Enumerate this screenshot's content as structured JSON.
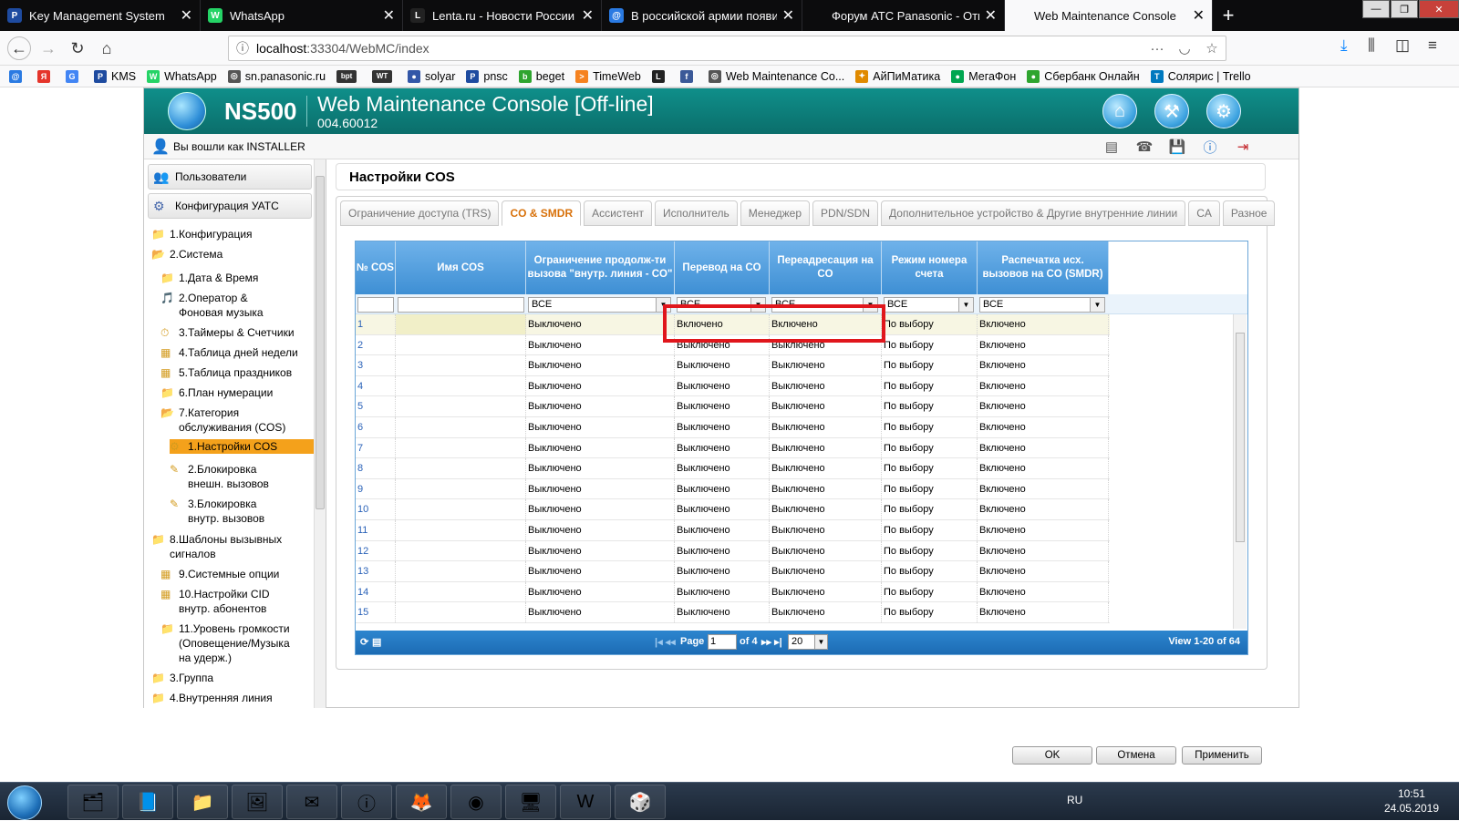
{
  "browser": {
    "tabs": [
      {
        "label": "Key Management System",
        "icon": "P",
        "color": "#1e4ba0"
      },
      {
        "label": "WhatsApp",
        "icon": "W",
        "color": "#25d366"
      },
      {
        "label": "Lenta.ru - Новости России и м",
        "icon": "L",
        "color": "#222222"
      },
      {
        "label": "В российской армии появила",
        "icon": "@",
        "color": "#2a7ae2"
      },
      {
        "label": "Форум АТС Panasonic - Ответить",
        "icon": "",
        "color": "#0c0c0d"
      },
      {
        "label": "Web Maintenance Console",
        "icon": "",
        "color": "#f9f9fa"
      }
    ],
    "url_prefix": "localhost",
    "url_rest": ":33304/WebMC/index",
    "bookmarks": [
      {
        "label": "",
        "icon": "@",
        "color": "#2a7ae2"
      },
      {
        "label": "",
        "icon": "Я",
        "color": "#e5352b"
      },
      {
        "label": "",
        "icon": "G",
        "color": "#4285f4"
      },
      {
        "label": "KMS",
        "icon": "P",
        "color": "#1e4ba0"
      },
      {
        "label": "WhatsApp",
        "icon": "W",
        "color": "#25d366"
      },
      {
        "label": "sn.panasonic.ru",
        "icon": "◎",
        "color": "#555555"
      },
      {
        "label": "",
        "icon": "bpt",
        "color": "#333333"
      },
      {
        "label": "",
        "icon": "WT",
        "color": "#333333"
      },
      {
        "label": "solyar",
        "icon": "●",
        "color": "#3357a8"
      },
      {
        "label": "pnsc",
        "icon": "P",
        "color": "#1e4ba0"
      },
      {
        "label": "beget",
        "icon": "b",
        "color": "#2fa52f"
      },
      {
        "label": "TimeWeb",
        "icon": ">",
        "color": "#f58220"
      },
      {
        "label": "",
        "icon": "L",
        "color": "#222222"
      },
      {
        "label": "",
        "icon": "f",
        "color": "#3b5998"
      },
      {
        "label": "Web Maintenance Co...",
        "icon": "◎",
        "color": "#555555"
      },
      {
        "label": "АйПиМатика",
        "icon": "✦",
        "color": "#e08a00"
      },
      {
        "label": "МегаФон",
        "icon": "●",
        "color": "#00a651"
      },
      {
        "label": "Сбербанк Онлайн",
        "icon": "●",
        "color": "#2fa52f"
      },
      {
        "label": "Солярис | Trello",
        "icon": "T",
        "color": "#0079bf"
      }
    ]
  },
  "app": {
    "model": "NS500",
    "title": "Web Maintenance Console [Off-line]",
    "version": "004.60012",
    "logged_in": "Вы вошли как INSTALLER",
    "sidebar": {
      "heads": [
        "Пользователи",
        "Конфигурация УАТС"
      ],
      "items": [
        "1.Конфигурация",
        "2.Система",
        "1.Дата & Время",
        "2.Оператор & Фоновая музыка",
        "3.Таймеры & Счетчики",
        "4.Таблица дней недели",
        "5.Таблица праздников",
        "6.План нумерации",
        "7.Категория обслуживания (COS)",
        "1.Настройки COS",
        "2.Блокировка внешн. вызовов",
        "3.Блокировка внутр. вызовов",
        "8.Шаблоны вызывных сигналов",
        "9.Системные опции",
        "10.Настройки CID внутр. абонентов",
        "11.Уровень громкости (Оповещение/Музыка на удерж.)",
        "3.Группа",
        "4.Внутренняя линия"
      ]
    },
    "page_title": "Настройки COS",
    "tabs": [
      "Ограничение доступа (TRS)",
      "CO & SMDR",
      "Ассистент",
      "Исполнитель",
      "Менеджер",
      "PDN/SDN",
      "Дополнительное устройство & Другие внутренние линии",
      "CA",
      "Разное"
    ],
    "active_tab": 1,
    "grid": {
      "columns": [
        "№ COS",
        "Имя COS",
        "Ограничение продолж-ти вызова \"внутр. линия - CO\"",
        "Перевод на CO",
        "Переадресация на CO",
        "Режим номера счета",
        "Распечатка исх. вызовов на CO (SMDR)"
      ],
      "filters": [
        "",
        "",
        "ВСЕ",
        "ВСЕ",
        "ВСЕ",
        "ВСЕ",
        "ВСЕ"
      ],
      "rows": [
        [
          "1",
          "",
          "Выключено",
          "Включено",
          "Включено",
          "По выбору",
          "Включено"
        ],
        [
          "2",
          "",
          "Выключено",
          "Выключено",
          "Выключено",
          "По выбору",
          "Включено"
        ],
        [
          "3",
          "",
          "Выключено",
          "Выключено",
          "Выключено",
          "По выбору",
          "Включено"
        ],
        [
          "4",
          "",
          "Выключено",
          "Выключено",
          "Выключено",
          "По выбору",
          "Включено"
        ],
        [
          "5",
          "",
          "Выключено",
          "Выключено",
          "Выключено",
          "По выбору",
          "Включено"
        ],
        [
          "6",
          "",
          "Выключено",
          "Выключено",
          "Выключено",
          "По выбору",
          "Включено"
        ],
        [
          "7",
          "",
          "Выключено",
          "Выключено",
          "Выключено",
          "По выбору",
          "Включено"
        ],
        [
          "8",
          "",
          "Выключено",
          "Выключено",
          "Выключено",
          "По выбору",
          "Включено"
        ],
        [
          "9",
          "",
          "Выключено",
          "Выключено",
          "Выключено",
          "По выбору",
          "Включено"
        ],
        [
          "10",
          "",
          "Выключено",
          "Выключено",
          "Выключено",
          "По выбору",
          "Включено"
        ],
        [
          "11",
          "",
          "Выключено",
          "Выключено",
          "Выключено",
          "По выбору",
          "Включено"
        ],
        [
          "12",
          "",
          "Выключено",
          "Выключено",
          "Выключено",
          "По выбору",
          "Включено"
        ],
        [
          "13",
          "",
          "Выключено",
          "Выключено",
          "Выключено",
          "По выбору",
          "Включено"
        ],
        [
          "14",
          "",
          "Выключено",
          "Выключено",
          "Выключено",
          "По выбору",
          "Включено"
        ],
        [
          "15",
          "",
          "Выключено",
          "Выключено",
          "Выключено",
          "По выбору",
          "Включено"
        ]
      ],
      "pager": {
        "page_label": "Page",
        "page": "1",
        "of": "of 4",
        "per_page": "20",
        "view": "View 1-20 of 64"
      }
    },
    "buttons": {
      "ok": "OK",
      "cancel": "Отмена",
      "apply": "Применить"
    }
  },
  "taskbar": {
    "apps": [
      "explorer",
      "notepad",
      "folder",
      "photo",
      "mail",
      "info",
      "firefox",
      "chrome",
      "remote",
      "word",
      "game"
    ],
    "lang": "RU",
    "time": "10:51",
    "date": "24.05.2019"
  }
}
